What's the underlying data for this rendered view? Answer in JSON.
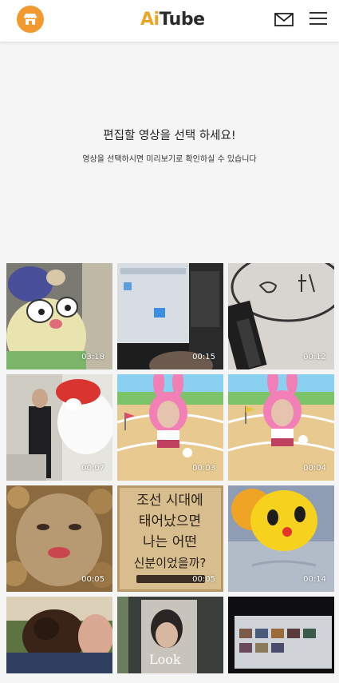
{
  "header": {
    "logo_ai": "Ai",
    "logo_tube": "Tube",
    "store_icon": "store-icon",
    "mail_icon": "mail-icon",
    "menu_icon": "hamburger-menu-icon",
    "accent_color": "#f29a2e"
  },
  "intro": {
    "title": "편집할 영상을 선택 하세요!",
    "subtitle": "영상을 선택하시면 미리보기로 확인하실 수 있습니다"
  },
  "videos": [
    {
      "duration": "03:18"
    },
    {
      "duration": "00:15"
    },
    {
      "duration": "00:12"
    },
    {
      "duration": "00:07"
    },
    {
      "duration": "00:03"
    },
    {
      "duration": "00:04"
    },
    {
      "duration": "00:05"
    },
    {
      "duration": "00:05",
      "caption_lines": [
        "조선 시대에",
        "태어났으면",
        "나는 어떤",
        "신분이었을까?"
      ]
    },
    {
      "duration": "00:14"
    },
    {
      "duration": ""
    },
    {
      "duration": "",
      "caption": "Look"
    },
    {
      "duration": ""
    }
  ]
}
